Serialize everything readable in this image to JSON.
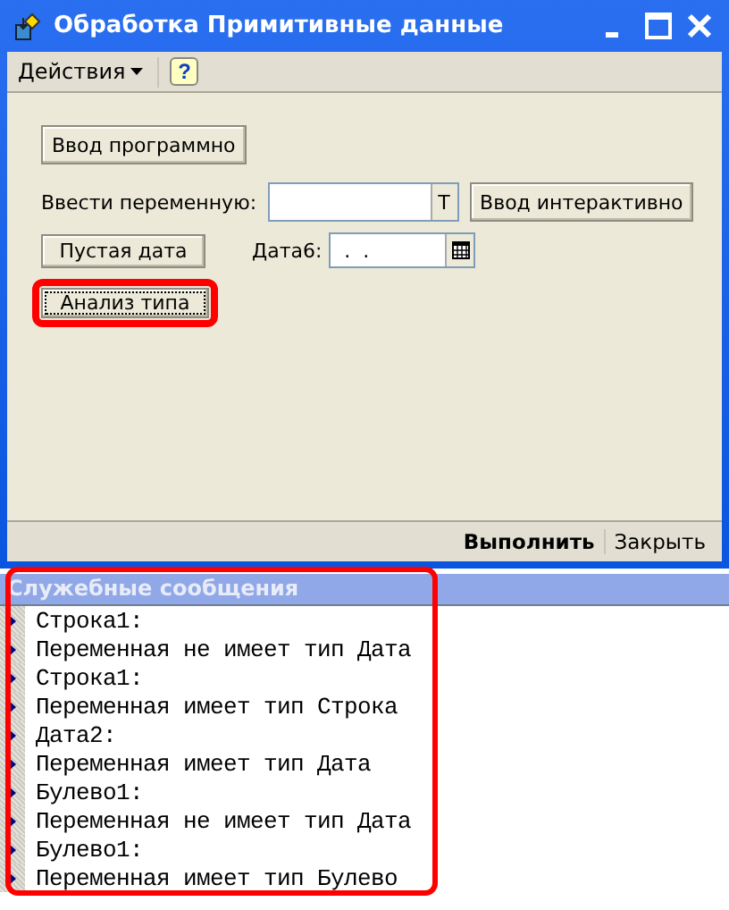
{
  "window": {
    "title": "Обработка  Примитивные данные"
  },
  "toolbar": {
    "menu": "Действия",
    "help": "?"
  },
  "form": {
    "program_button": "Ввод программно",
    "variable_label": "Ввести переменную:",
    "type_button": "T",
    "interactive_button": "Ввод интерактивно",
    "empty_date_button": "Пустая дата",
    "date_label": "Дата6:",
    "date_value": " .  .",
    "analyze_button": "Анализ типа",
    "analyze_highlighted": true
  },
  "bottom_bar": {
    "buttons": [
      {
        "label": "Выполнить",
        "default": true
      },
      {
        "label": "Закрыть",
        "default": false
      }
    ]
  },
  "messages": {
    "title": "Служебные сообщения",
    "highlighted": true,
    "items": [
      {
        "text": "Строка1:"
      },
      {
        "text": "Переменная не имеет тип Дата"
      },
      {
        "text": "Строка1:"
      },
      {
        "text": "Переменная имеет тип Строка"
      },
      {
        "text": "Дата2:"
      },
      {
        "text": "Переменная имеет тип Дата"
      },
      {
        "text": "Булево1:"
      },
      {
        "text": "Переменная не имеет тип Дата"
      },
      {
        "text": "Булево1:"
      },
      {
        "text": "Переменная имеет тип Булево"
      }
    ]
  }
}
